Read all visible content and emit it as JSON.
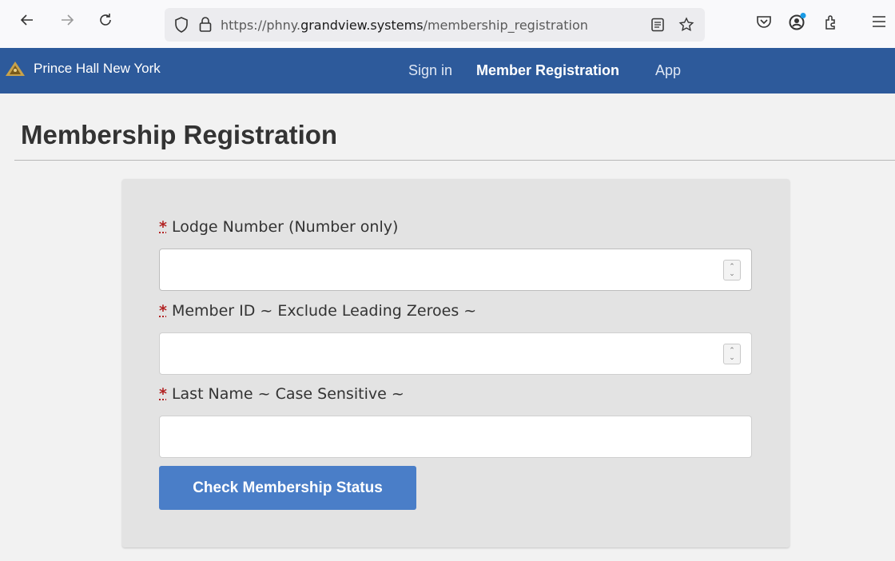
{
  "browser": {
    "url_prefix": "https://phny.",
    "url_host": "grandview.systems",
    "url_path": "/membership_registration"
  },
  "navbar": {
    "brand": "Prince Hall New York",
    "links": [
      "Sign in",
      "Member Registration",
      "App"
    ],
    "active_link": "Member Registration"
  },
  "page": {
    "title": "Membership Registration"
  },
  "form": {
    "fields": [
      {
        "required_mark": "*",
        "label": "Lodge Number (Number only)",
        "value": ""
      },
      {
        "required_mark": "*",
        "label": "Member ID ~ Exclude Leading Zeroes ~",
        "value": ""
      },
      {
        "required_mark": "*",
        "label": "Last Name ~ Case Sensitive ~",
        "value": ""
      }
    ],
    "submit_label": "Check Membership Status"
  },
  "colors": {
    "navbar_bg": "#2d5a9b",
    "button_bg": "#4a7ec8",
    "required": "#b22222"
  },
  "icons": {
    "back": "arrow-left-icon",
    "forward": "arrow-right-icon",
    "reload": "reload-icon",
    "shield": "shield-icon",
    "lock": "lock-icon",
    "reader": "reader-view-icon",
    "bookmark": "star-icon",
    "pocket": "pocket-icon",
    "account": "account-icon",
    "extensions": "extensions-icon",
    "menu": "hamburger-menu-icon"
  }
}
